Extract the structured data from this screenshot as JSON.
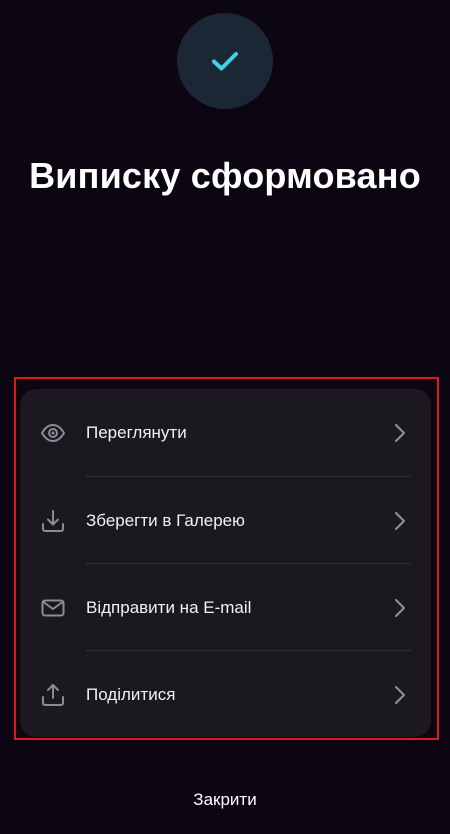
{
  "header": {
    "status_icon": "checkmark-icon",
    "title": "Виписку сформовано"
  },
  "actions": [
    {
      "label": "Переглянути",
      "icon": "eye-icon"
    },
    {
      "label": "Зберегти в Галерею",
      "icon": "download-icon"
    },
    {
      "label": "Відправити на E-mail",
      "icon": "mail-icon"
    },
    {
      "label": "Поділитися",
      "icon": "share-icon"
    }
  ],
  "footer": {
    "close_label": "Закрити"
  },
  "colors": {
    "background": "#0b0612",
    "card": "#1b1820",
    "accent": "#3fd2e8",
    "circle": "#1c2736",
    "icon": "#8e8a96",
    "highlight": "#e0191c"
  }
}
